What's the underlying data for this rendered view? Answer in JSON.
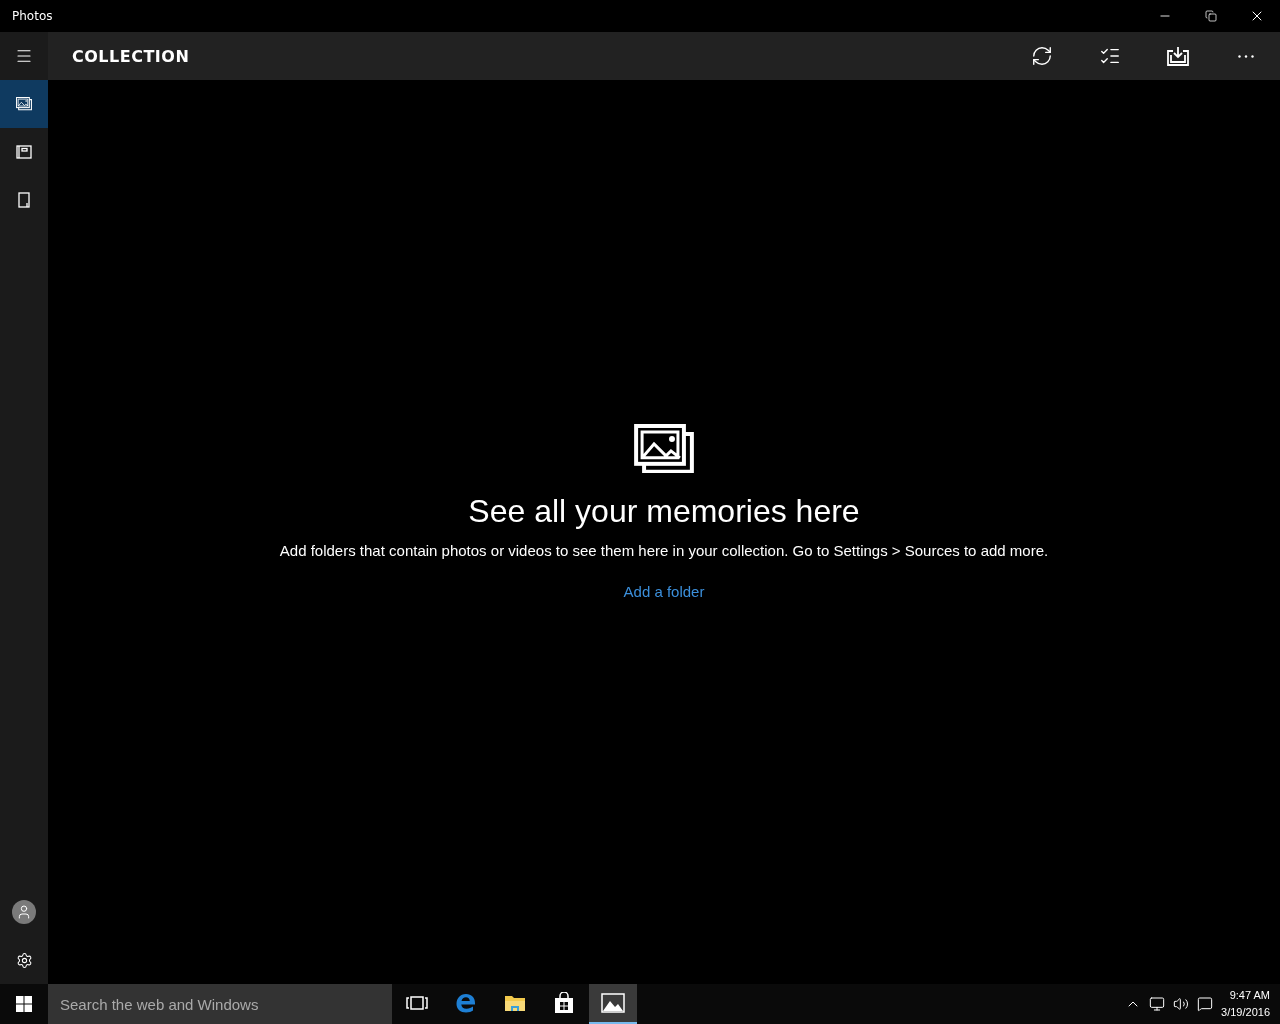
{
  "window": {
    "title": "Photos"
  },
  "header": {
    "title": "COLLECTION"
  },
  "nav_items": [
    {
      "kind": "collection",
      "selected": true
    },
    {
      "kind": "albums",
      "selected": false
    },
    {
      "kind": "folders",
      "selected": false
    }
  ],
  "empty_state": {
    "heading": "See all your memories here",
    "message": "Add folders that contain photos or videos to see them here in your collection. Go to Settings > Sources to add more.",
    "link": "Add a folder"
  },
  "taskbar": {
    "search": {
      "placeholder": "Search the web and Windows"
    },
    "apps": [
      {
        "kind": "taskview",
        "active": false
      },
      {
        "kind": "edge",
        "active": false
      },
      {
        "kind": "explorer",
        "active": false
      },
      {
        "kind": "store",
        "active": false
      },
      {
        "kind": "photos",
        "active": true
      }
    ],
    "time": "9:47 AM",
    "date": "3/19/2016"
  }
}
